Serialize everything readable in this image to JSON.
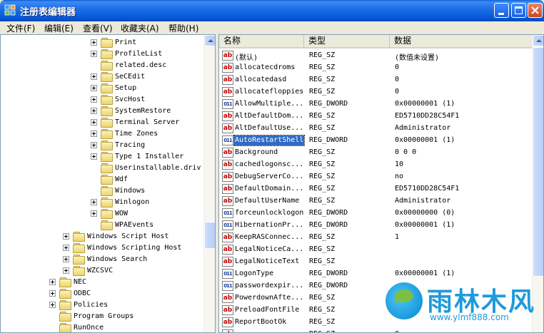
{
  "window": {
    "title": "注册表编辑器"
  },
  "menu": [
    "文件(F)",
    "编辑(E)",
    "查看(V)",
    "收藏夹(A)",
    "帮助(H)"
  ],
  "tree": [
    {
      "label": "Print",
      "expandable": true,
      "level": 3
    },
    {
      "label": "ProfileList",
      "expandable": true,
      "level": 3
    },
    {
      "label": "related.desc",
      "expandable": false,
      "level": 3
    },
    {
      "label": "SeCEdit",
      "expandable": true,
      "level": 3
    },
    {
      "label": "Setup",
      "expandable": true,
      "level": 3
    },
    {
      "label": "SvcHost",
      "expandable": true,
      "level": 3
    },
    {
      "label": "SystemRestore",
      "expandable": true,
      "level": 3
    },
    {
      "label": "Terminal Server",
      "expandable": true,
      "level": 3
    },
    {
      "label": "Time Zones",
      "expandable": true,
      "level": 3
    },
    {
      "label": "Tracing",
      "expandable": true,
      "level": 3
    },
    {
      "label": "Type 1 Installer",
      "expandable": true,
      "level": 3
    },
    {
      "label": "Userinstallable.driv",
      "expandable": false,
      "level": 3
    },
    {
      "label": "Wdf",
      "expandable": false,
      "level": 3
    },
    {
      "label": "Windows",
      "expandable": false,
      "level": 3
    },
    {
      "label": "Winlogon",
      "expandable": true,
      "level": 3
    },
    {
      "label": "WOW",
      "expandable": true,
      "level": 3
    },
    {
      "label": "WPAEvents",
      "expandable": false,
      "level": 3
    },
    {
      "label": "Windows Script Host",
      "expandable": true,
      "level": 2
    },
    {
      "label": "Windows Scripting Host",
      "expandable": true,
      "level": 2
    },
    {
      "label": "Windows Search",
      "expandable": true,
      "level": 2
    },
    {
      "label": "WZCSVC",
      "expandable": true,
      "level": 2
    },
    {
      "label": "NEC",
      "expandable": true,
      "level": 1
    },
    {
      "label": "ODBC",
      "expandable": true,
      "level": 1
    },
    {
      "label": "Policies",
      "expandable": true,
      "level": 1
    },
    {
      "label": "Program Groups",
      "expandable": false,
      "level": 1
    },
    {
      "label": "RunOnce",
      "expandable": false,
      "level": 1
    }
  ],
  "list": {
    "headers": {
      "name": "名称",
      "type": "类型",
      "data": "数据"
    },
    "rows": [
      {
        "icon": "string-value-icon",
        "name": "(默认)",
        "type": "REG_SZ",
        "data": "(数值未设置)"
      },
      {
        "icon": "string-value-icon",
        "name": "allocatecdroms",
        "type": "REG_SZ",
        "data": "0"
      },
      {
        "icon": "string-value-icon",
        "name": "allocatedasd",
        "type": "REG_SZ",
        "data": "0"
      },
      {
        "icon": "string-value-icon",
        "name": "allocatefloppies",
        "type": "REG_SZ",
        "data": "0"
      },
      {
        "icon": "dword-value-icon",
        "name": "AllowMultiple...",
        "type": "REG_DWORD",
        "data": "0x00000001 (1)"
      },
      {
        "icon": "string-value-icon",
        "name": "AltDefaultDom...",
        "type": "REG_SZ",
        "data": "ED5710DD28C54F1"
      },
      {
        "icon": "string-value-icon",
        "name": "AltDefaultUse...",
        "type": "REG_SZ",
        "data": "Administrator"
      },
      {
        "icon": "dword-value-icon",
        "name": "AutoRestartShell",
        "type": "REG_DWORD",
        "data": "0x00000001 (1)",
        "selected": true
      },
      {
        "icon": "string-value-icon",
        "name": "Background",
        "type": "REG_SZ",
        "data": "0 0 0"
      },
      {
        "icon": "string-value-icon",
        "name": "cachedlogonsc...",
        "type": "REG_SZ",
        "data": "10"
      },
      {
        "icon": "string-value-icon",
        "name": "DebugServerCo...",
        "type": "REG_SZ",
        "data": "no"
      },
      {
        "icon": "string-value-icon",
        "name": "DefaultDomain...",
        "type": "REG_SZ",
        "data": "ED5710DD28C54F1"
      },
      {
        "icon": "string-value-icon",
        "name": "DefaultUserName",
        "type": "REG_SZ",
        "data": "Administrator"
      },
      {
        "icon": "dword-value-icon",
        "name": "forceunlocklogon",
        "type": "REG_DWORD",
        "data": "0x00000000 (0)"
      },
      {
        "icon": "dword-value-icon",
        "name": "HibernationPr...",
        "type": "REG_DWORD",
        "data": "0x00000001 (1)"
      },
      {
        "icon": "string-value-icon",
        "name": "KeepRASConnec...",
        "type": "REG_SZ",
        "data": "1"
      },
      {
        "icon": "string-value-icon",
        "name": "LegalNoticeCa...",
        "type": "REG_SZ",
        "data": ""
      },
      {
        "icon": "string-value-icon",
        "name": "LegalNoticeText",
        "type": "REG_SZ",
        "data": ""
      },
      {
        "icon": "dword-value-icon",
        "name": "LogonType",
        "type": "REG_DWORD",
        "data": "0x00000001 (1)"
      },
      {
        "icon": "dword-value-icon",
        "name": "passwordexpir...",
        "type": "REG_DWORD",
        "data": ""
      },
      {
        "icon": "string-value-icon",
        "name": "PowerdownAfte...",
        "type": "REG_SZ",
        "data": ""
      },
      {
        "icon": "string-value-icon",
        "name": "PreloadFontFile",
        "type": "REG_SZ",
        "data": ""
      },
      {
        "icon": "string-value-icon",
        "name": "ReportBootOk",
        "type": "REG_SZ",
        "data": ""
      },
      {
        "icon": "string-value-icon",
        "name": "",
        "type": "REG_SZ",
        "data": "0"
      }
    ]
  },
  "watermark": {
    "text": "雨林木风",
    "url": "www.ylmf888.com"
  }
}
